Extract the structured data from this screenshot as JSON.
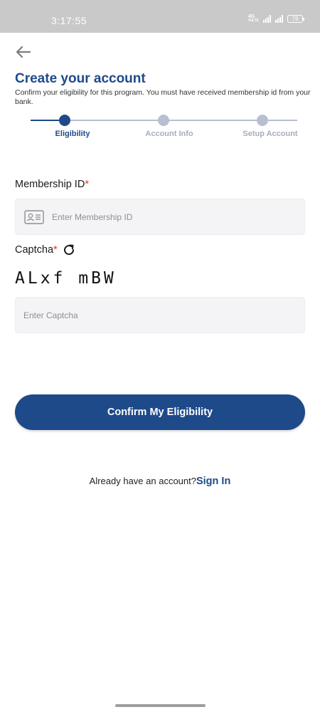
{
  "status_bar": {
    "time": "3:17:55",
    "network_label": "4G",
    "network_sub": "VoLTE",
    "battery": "78"
  },
  "header": {
    "back_icon": "arrow-left-icon",
    "title": "Create your account",
    "subtitle": "Confirm your eligibility for this program. You must have received membership id from your bank."
  },
  "stepper": {
    "steps": [
      {
        "label": "Eligibility",
        "active": true
      },
      {
        "label": "Account Info",
        "active": false
      },
      {
        "label": "Setup Account",
        "active": false
      }
    ]
  },
  "form": {
    "membership": {
      "label": "Membership ID",
      "required_mark": "*",
      "placeholder": "Enter Membership ID",
      "value": "",
      "icon": "id-card-icon"
    },
    "captcha": {
      "label": "Captcha",
      "required_mark": "*",
      "refresh_icon": "refresh-icon",
      "code": "ALxf mBW",
      "placeholder": "Enter Captcha",
      "value": ""
    },
    "submit_label": "Confirm My Eligibility"
  },
  "footer": {
    "prompt": "Already have an account?",
    "link": "Sign In"
  },
  "colors": {
    "primary": "#1e4a8a",
    "inactive_step": "#b8bfd0",
    "required": "#d9342b",
    "input_bg": "#f4f3f6"
  }
}
